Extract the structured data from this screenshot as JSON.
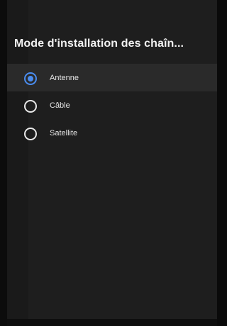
{
  "dialog": {
    "title": "Mode d'installation des chaîn..."
  },
  "options": [
    {
      "label": "Antenne",
      "selected": true,
      "focused": true
    },
    {
      "label": "Câble",
      "selected": false,
      "focused": false
    },
    {
      "label": "Satellite",
      "selected": false,
      "focused": false
    }
  ],
  "colors": {
    "accent": "#4a8df0",
    "panel_background": "#1e1e1e",
    "focused_row": "#2a2a2a"
  },
  "icons": {
    "selected": "radio-checked-icon",
    "unselected": "radio-unchecked-icon"
  }
}
